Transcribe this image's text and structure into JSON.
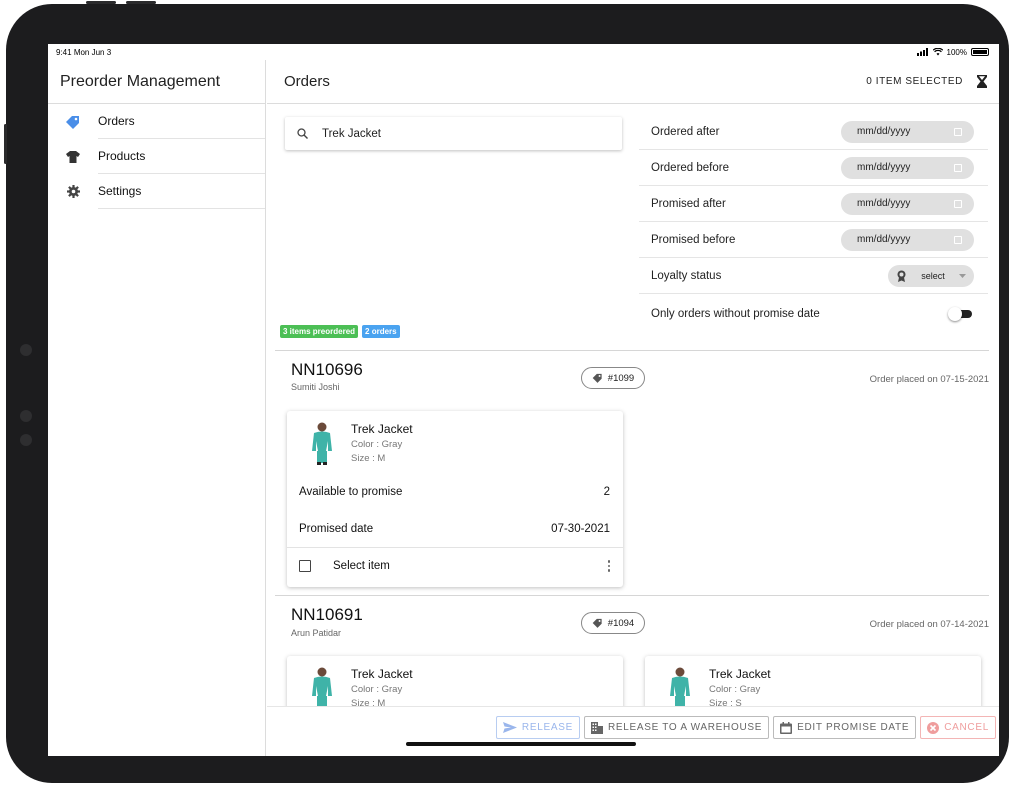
{
  "status_bar": {
    "time": "9:41",
    "date": "Mon Jun 3",
    "battery": "100%"
  },
  "sidebar": {
    "title": "Preorder Management",
    "items": [
      {
        "label": "Orders",
        "icon": "tag-icon",
        "active": true
      },
      {
        "label": "Products",
        "icon": "shirt-icon",
        "active": false
      },
      {
        "label": "Settings",
        "icon": "gear-icon",
        "active": false
      }
    ]
  },
  "header": {
    "title": "Orders",
    "selected_count": "0 ITEM SELECTED",
    "hourglass_icon": "hourglass-icon"
  },
  "search": {
    "value": "Trek Jacket",
    "icon": "search-icon"
  },
  "filters": {
    "ordered_after": {
      "label": "Ordered after",
      "placeholder": "mm/dd/yyyy"
    },
    "ordered_before": {
      "label": "Ordered before",
      "placeholder": "mm/dd/yyyy"
    },
    "promised_after": {
      "label": "Promised after",
      "placeholder": "mm/dd/yyyy"
    },
    "promised_before": {
      "label": "Promised before",
      "placeholder": "mm/dd/yyyy"
    },
    "loyalty_status": {
      "label": "Loyalty status",
      "value": "select"
    },
    "without_promise": {
      "label": "Only orders without promise date",
      "on": false
    }
  },
  "summary": {
    "items_badge": "3 items preordered",
    "orders_badge": "2 orders",
    "items_color": "#4cbf55",
    "orders_color": "#4aa3f0"
  },
  "orders": [
    {
      "id": "NN10696",
      "customer": "Sumiti Joshi",
      "tag": "#1099",
      "placed": "Order placed on 07-15-2021",
      "items": [
        {
          "name": "Trek Jacket",
          "color": "Color : Gray",
          "size": "Size : M",
          "atp_label": "Available to promise",
          "atp_value": "2",
          "promised_label": "Promised date",
          "promised_value": "07-30-2021",
          "select_label": "Select item"
        }
      ]
    },
    {
      "id": "NN10691",
      "customer": "Arun Patidar",
      "tag": "#1094",
      "placed": "Order placed on 07-14-2021",
      "items": [
        {
          "name": "Trek Jacket",
          "color": "Color : Gray",
          "size": "Size : M"
        },
        {
          "name": "Trek Jacket",
          "color": "Color : Gray",
          "size": "Size : S"
        }
      ]
    }
  ],
  "actions": {
    "release": "RELEASE",
    "release_warehouse": "RELEASE TO A WAREHOUSE",
    "edit_promise": "EDIT PROMISE DATE",
    "cancel": "CANCEL"
  },
  "colors": {
    "accent": "#3880ff",
    "release": "#9ab6ec",
    "cancel": "#ef9d9d",
    "jacket": "#3fb3a8"
  }
}
